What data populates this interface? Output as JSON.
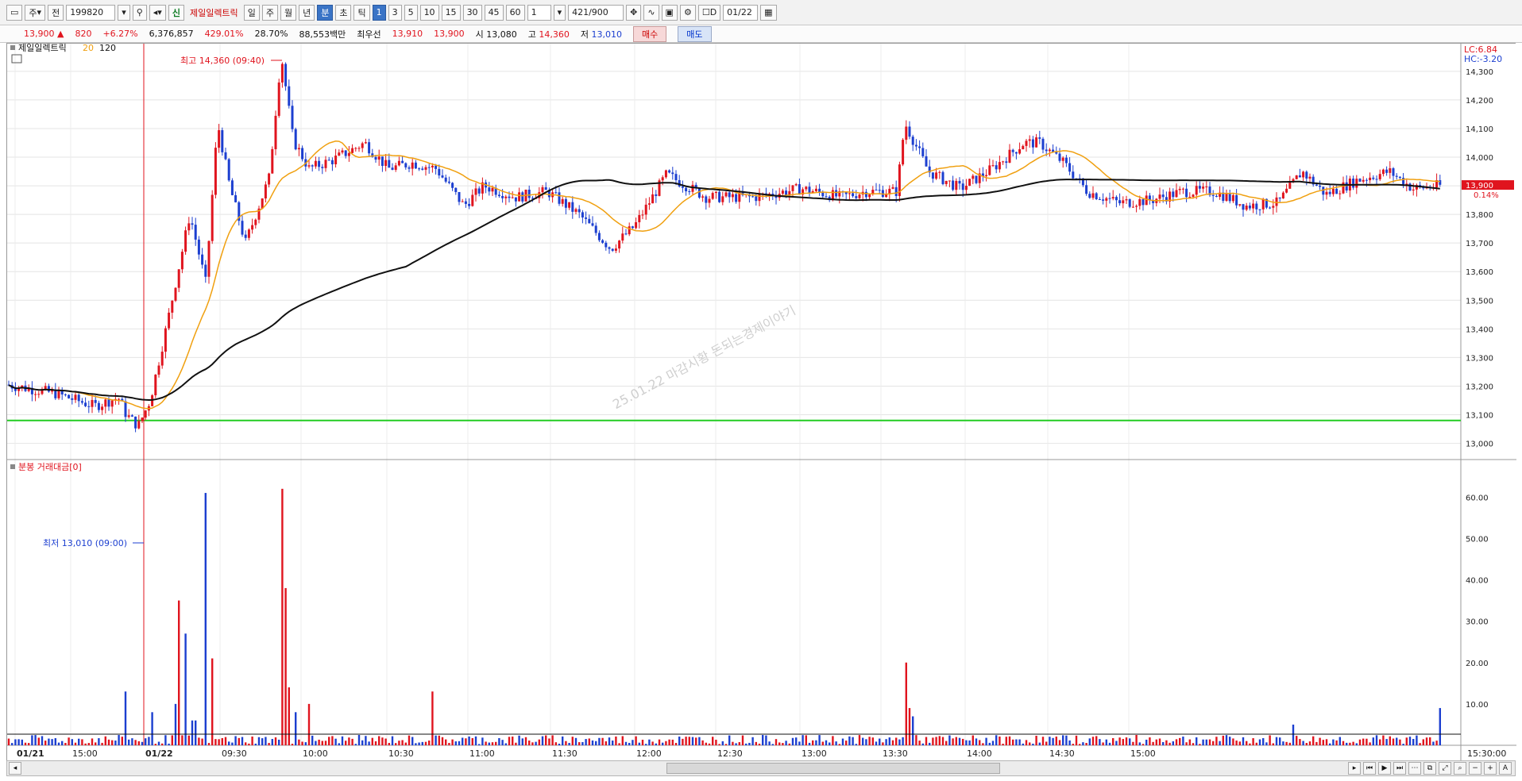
{
  "toolbar": {
    "type1": "주",
    "type2": "전",
    "code": "199820",
    "sin": "신",
    "stock_name": "제일일렉트릭",
    "periods": [
      "일",
      "주",
      "월",
      "년",
      "분",
      "초",
      "틱"
    ],
    "active_period": "분",
    "intervals": [
      "1",
      "3",
      "5",
      "10",
      "15",
      "30",
      "45",
      "60"
    ],
    "active_interval": "1",
    "unit": "1",
    "count": "421",
    "count_max": "/900",
    "d_label": "D",
    "date": "01/22"
  },
  "quote": {
    "price": "13,900",
    "arrow": "▲",
    "change": "820",
    "change_pct": "+6.27%",
    "volume": "6,376,857",
    "vol_ratio": "429.01%",
    "turnover": "28.70%",
    "amount": "88,553백만",
    "best_label": "최우선",
    "best_ask": "13,910",
    "best_bid": "13,900",
    "open_label": "시",
    "open": "13,080",
    "high_label": "고",
    "high": "14,360",
    "low_label": "저",
    "low": "13,010",
    "buy": "매수",
    "sell": "매도"
  },
  "chart": {
    "legend_name": "제일일렉트릭",
    "ma1": "20",
    "ma2": "120",
    "lc": "LC:6.84",
    "hc": "HC:-3.20",
    "current_tag": "13,900",
    "current_pct": "0.14%",
    "high_note": "최고 14,360 (09:40)",
    "low_note": "최저 13,010 (09:00)",
    "watermark": "25.01.22 마감시황 돈되는경제이야기",
    "y_labels": [
      "14,300",
      "14,200",
      "14,100",
      "14,000",
      "13,900",
      "13,800",
      "13,700",
      "13,600",
      "13,500",
      "13,400",
      "13,300",
      "13,200",
      "13,100",
      "13,000"
    ],
    "x_labels": [
      "01/21",
      "15:00",
      "01/22",
      "09:30",
      "10:00",
      "10:30",
      "11:00",
      "11:30",
      "12:00",
      "12:30",
      "13:00",
      "13:30",
      "14:00",
      "14:30",
      "15:00"
    ],
    "last_time": "15:30:00",
    "volume_title": "분봉 거래대금[0]",
    "vol_labels": [
      "60.00",
      "50.00",
      "40.00",
      "30.00",
      "20.00",
      "10.00"
    ],
    "colors": {
      "up": "#e0141e",
      "down": "#1c3fd0",
      "ma20": "#f0a010",
      "ma120": "#111111",
      "support": "#22cc22"
    }
  },
  "chart_data": {
    "type": "candlestick",
    "symbol": "199820",
    "ylim": [
      12960,
      14380
    ],
    "high": 14360,
    "low": 13010,
    "open": 13080,
    "close": 13900,
    "support_level": 13080,
    "ma20_last": 13925,
    "ma120_last": 13880,
    "volume_peaks": [
      {
        "time": "09:00",
        "value": 13
      },
      {
        "time": "09:20",
        "value": 35
      },
      {
        "time": "09:26",
        "value": 61
      },
      {
        "time": "09:40",
        "value": 62
      },
      {
        "time": "09:41",
        "value": 38
      },
      {
        "time": "10:27",
        "value": 13
      },
      {
        "time": "12:51",
        "value": 20
      },
      {
        "time": "15:30",
        "value": 9
      }
    ]
  }
}
